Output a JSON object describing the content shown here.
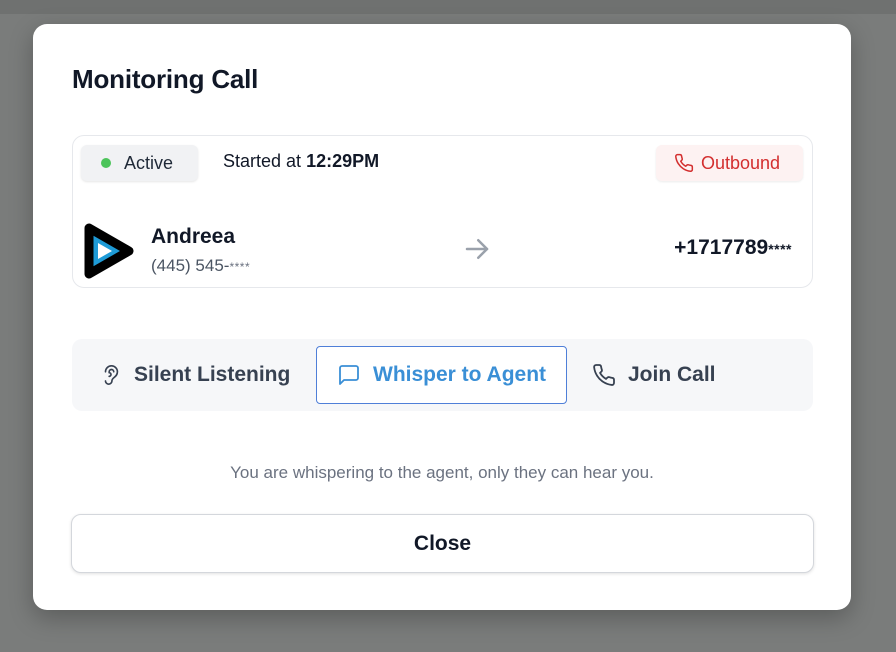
{
  "dialog": {
    "title": "Monitoring Call"
  },
  "call": {
    "status_label": "Active",
    "status_color": "#4cc45a",
    "started_prefix": "Started at",
    "started_time": "12:29PM",
    "direction_label": "Outbound",
    "direction_color": "#d32f2f",
    "agent": {
      "name": "Andreea",
      "phone_prefix": "(445) 545-",
      "phone_masked": "****",
      "avatar_icon": "play-logo-icon"
    },
    "arrow_icon": "arrow-right-icon",
    "destination": {
      "number_prefix": "+1717789",
      "number_masked": "****"
    }
  },
  "modes": [
    {
      "label": "Silent Listening",
      "icon": "ear-icon",
      "selected": false
    },
    {
      "label": "Whisper to Agent",
      "icon": "message-square-icon",
      "selected": true
    },
    {
      "label": "Join Call",
      "icon": "phone-icon",
      "selected": false
    }
  ],
  "hint": "You are whispering to the agent, only they can hear you.",
  "close_label": "Close",
  "colors": {
    "accent": "#3a8fd6",
    "accent_border": "#4f7fd8",
    "backdrop": "#7a7c7b"
  }
}
